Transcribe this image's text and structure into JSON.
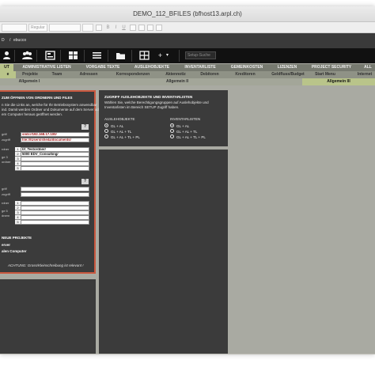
{
  "window": {
    "title": "DEMO_112_BFILES (bfhost13.arpl.ch)"
  },
  "formatbar": {
    "font_placeholder": "Regular",
    "bold": "B",
    "italic": "I",
    "underline": "U"
  },
  "navbar": {
    "left_text": "D",
    "user": "ebucco"
  },
  "toolbar": {
    "add_label": "+",
    "search_placeholder": "Setup-Suche"
  },
  "tabs_row1": [
    "UT",
    "ADMINISTRATIVE LISTEN",
    "VORGABE TEXTE",
    "AUSLEHOBJEKTE",
    "INVENTARLISTE",
    "GEMEINKOSTEN",
    "LIZENZEN",
    "PROJECT SECURITY",
    "ALL"
  ],
  "tabs_row2": [
    "e",
    "Projekte",
    "Team",
    "Adressen",
    "Korrespondenzen",
    "Aktennotiz",
    "Debitoren",
    "Kreditoren",
    "Geldfluss/Budget",
    "Start Menu",
    "Internet"
  ],
  "tabs_row3": [
    "Allgemein I",
    "Allgemein II",
    "Allgemein III"
  ],
  "left_panel": {
    "title": "ZUM ÖFFNEN VON ORDNERN UND FILES",
    "desc_lines": [
      "n Sie die Links an, welche für Ihr Betriebssystem anwendbar",
      "ind. Damit werden Ordner und Dokumente auf dem Server oder lokal",
      "em Computer heraus geöffnet werden."
    ],
    "help1": "?",
    "help2": "?",
    "group1": {
      "labels": [
        "griff",
        "zugriff",
        "rdner",
        "0",
        "ge 3",
        "ordner"
      ],
      "url1": "smb://192.168.17.100/",
      "url2": "file:///Users/sheila/documents/",
      "rows": [
        {
          "n": "1",
          "v": "bf_Testordner/"
        },
        {
          "n": "2",
          "v": "5000 EDV_Consulting/"
        },
        {
          "n": "3",
          "v": ""
        },
        {
          "n": "4",
          "v": ""
        },
        {
          "n": "5",
          "v": ""
        }
      ]
    },
    "group2": {
      "labels": [
        "griff",
        "zugriff",
        "rdner",
        "ge 5",
        "dnern"
      ],
      "rows": [
        {
          "n": "1",
          "v": ""
        },
        {
          "n": "2",
          "v": ""
        },
        {
          "n": "3",
          "v": ""
        },
        {
          "n": "4",
          "v": ""
        },
        {
          "n": "5",
          "v": ""
        }
      ]
    },
    "new_projects_title": "NEUE PROJEKTE",
    "new_projects_lines": [
      "erver",
      "alen Computer"
    ],
    "warning": "ACHTUNG: Gross/Kleinschreibung ist relevant !"
  },
  "right_panel": {
    "title": "ZUGRIFF AUSLEHOBJEKTE UND INVENTARLISTEN",
    "desc_lines": [
      "Wählen Sie, welche Berechtigungsgruppen auf Auslehobjekte und",
      "Inventarlisten im Bereich SETUP Zugriff haben."
    ],
    "col1_title": "AUSLEHOBJEKTE",
    "col2_title": "INVENTARLISTEN",
    "col1_options": [
      "GL + AL",
      "GL + AL + TL",
      "GL + AL + TL + PL"
    ],
    "col2_options": [
      "GL + AL",
      "GL + AL + TL",
      "GL + AL + TL + PL"
    ]
  }
}
